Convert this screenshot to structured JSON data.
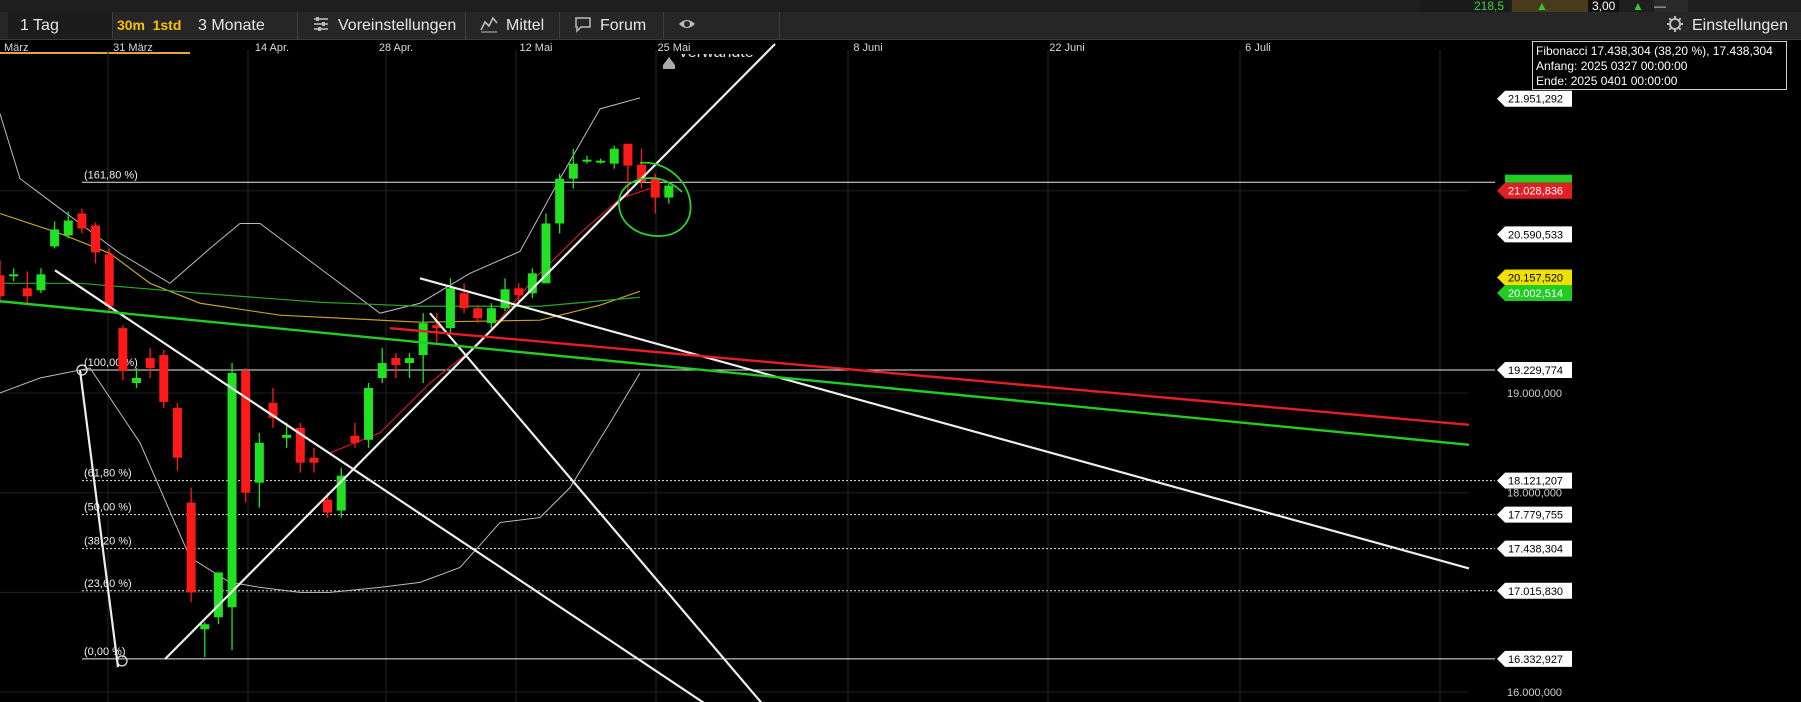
{
  "top_strip": {
    "value1": "218,5",
    "value2": "3,00",
    "tail": "—"
  },
  "toolbar": {
    "range_label": "1 Tag",
    "interval_a": "30m",
    "interval_b": "1std",
    "period_label": "3 Monate",
    "presets_label": "Voreinstellungen",
    "indicator_label": "Mittel",
    "forum_label": "Forum",
    "related_label": "Verwandte",
    "settings_label": "Einstellungen"
  },
  "tooltip": {
    "line1": "Fibonacci 17.438,304 (38,20 %), 17.438,304",
    "line2": "Anfang: 2025 0327 00:00:00",
    "line3": "Ende: 2025 0401 00:00:00"
  },
  "colors": {
    "up": "#22e022",
    "down": "#ff1a1a",
    "line": "#ffffff",
    "price_red": "#e31e24",
    "price_green": "#22cc22",
    "price_yellow": "#f0e000"
  },
  "chart_data": {
    "type": "candlestick",
    "ylim": [
      15900,
      22400
    ],
    "x_tick_labels": [
      "März",
      "31 März",
      "14 Apr.",
      "28 Apr.",
      "12 Mai",
      "25 Mai",
      "8 Juni",
      "22 Juni",
      "6 Juli"
    ],
    "y_tick_labels": [
      "19.000,000",
      "18.000,000",
      "16.000,000"
    ],
    "y_tick_values": [
      19000,
      18000,
      16000
    ],
    "price_labels": [
      {
        "text": "21.951,292",
        "value": 21951.292,
        "style": "white"
      },
      {
        "text": "21.028,836",
        "value": 21028.836,
        "style": "red"
      },
      {
        "text": "20.590,533",
        "value": 20590.533,
        "style": "white"
      },
      {
        "text": "20.157,520",
        "value": 20157.52,
        "style": "yellow"
      },
      {
        "text": "20.002,514",
        "value": 20002.514,
        "style": "green"
      },
      {
        "text": "19.229,774",
        "value": 19229.774,
        "style": "white"
      },
      {
        "text": "18.121,207",
        "value": 18121.207,
        "style": "white"
      },
      {
        "text": "17.779,755",
        "value": 17779.755,
        "style": "white"
      },
      {
        "text": "17.438,304",
        "value": 17438.304,
        "style": "white"
      },
      {
        "text": "17.015,830",
        "value": 17015.83,
        "style": "white"
      },
      {
        "text": "16.332,927",
        "value": 16332.927,
        "style": "white"
      }
    ],
    "fibonacci": [
      {
        "label": "(161,80 %)",
        "value": 21113.3
      },
      {
        "label": "(100,00 %)",
        "value": 19229.774
      },
      {
        "label": "(61,80 %)",
        "value": 18121.207
      },
      {
        "label": "(50,00 %)",
        "value": 17779.755
      },
      {
        "label": "(38,20 %)",
        "value": 17438.304
      },
      {
        "label": "(23,60 %)",
        "value": 17015.83
      },
      {
        "label": "(0,00 %)",
        "value": 16332.927
      }
    ],
    "candles": [
      {
        "o": 20180,
        "h": 20330,
        "l": 19900,
        "c": 19970
      },
      {
        "o": 20170,
        "h": 20250,
        "l": 20120,
        "c": 20190
      },
      {
        "o": 20050,
        "h": 20220,
        "l": 19880,
        "c": 19970
      },
      {
        "o": 20030,
        "h": 20250,
        "l": 20000,
        "c": 20190
      },
      {
        "o": 20470,
        "h": 20720,
        "l": 20450,
        "c": 20640
      },
      {
        "o": 20580,
        "h": 20820,
        "l": 20550,
        "c": 20730
      },
      {
        "o": 20800,
        "h": 20850,
        "l": 20600,
        "c": 20650
      },
      {
        "o": 20680,
        "h": 20710,
        "l": 20300,
        "c": 20410
      },
      {
        "o": 20390,
        "h": 20450,
        "l": 19800,
        "c": 19870
      },
      {
        "o": 19650,
        "h": 19680,
        "l": 19130,
        "c": 19220
      },
      {
        "o": 19100,
        "h": 19250,
        "l": 19050,
        "c": 19150
      },
      {
        "o": 19350,
        "h": 19450,
        "l": 19150,
        "c": 19250
      },
      {
        "o": 19380,
        "h": 19430,
        "l": 18850,
        "c": 18910
      },
      {
        "o": 18850,
        "h": 18900,
        "l": 18220,
        "c": 18350
      },
      {
        "o": 17900,
        "h": 18050,
        "l": 16900,
        "c": 17000
      },
      {
        "o": 16630,
        "h": 16700,
        "l": 16350,
        "c": 16680
      },
      {
        "o": 16750,
        "h": 17200,
        "l": 16680,
        "c": 17200
      },
      {
        "o": 16850,
        "h": 19300,
        "l": 16420,
        "c": 19200
      },
      {
        "o": 19220,
        "h": 19250,
        "l": 17900,
        "c": 18000
      },
      {
        "o": 18100,
        "h": 18600,
        "l": 17850,
        "c": 18500
      },
      {
        "o": 18900,
        "h": 19050,
        "l": 18650,
        "c": 18750
      },
      {
        "o": 18550,
        "h": 18700,
        "l": 18450,
        "c": 18580
      },
      {
        "o": 18650,
        "h": 18700,
        "l": 18200,
        "c": 18300
      },
      {
        "o": 18350,
        "h": 18450,
        "l": 18200,
        "c": 18300
      },
      {
        "o": 17930,
        "h": 18000,
        "l": 17750,
        "c": 17800
      },
      {
        "o": 17820,
        "h": 18250,
        "l": 17750,
        "c": 18170
      },
      {
        "o": 18570,
        "h": 18700,
        "l": 18450,
        "c": 18500
      },
      {
        "o": 18530,
        "h": 19100,
        "l": 18450,
        "c": 19050
      },
      {
        "o": 19150,
        "h": 19450,
        "l": 19100,
        "c": 19300
      },
      {
        "o": 19350,
        "h": 19400,
        "l": 19150,
        "c": 19280
      },
      {
        "o": 19300,
        "h": 19400,
        "l": 19150,
        "c": 19350
      },
      {
        "o": 19380,
        "h": 19800,
        "l": 19100,
        "c": 19700
      },
      {
        "o": 19680,
        "h": 19800,
        "l": 19500,
        "c": 19650
      },
      {
        "o": 19650,
        "h": 20150,
        "l": 19600,
        "c": 20050
      },
      {
        "o": 20000,
        "h": 20100,
        "l": 19800,
        "c": 19850
      },
      {
        "o": 19850,
        "h": 19880,
        "l": 19700,
        "c": 19750
      },
      {
        "o": 19700,
        "h": 19900,
        "l": 19650,
        "c": 19850
      },
      {
        "o": 19850,
        "h": 20150,
        "l": 19820,
        "c": 20040
      },
      {
        "o": 20050,
        "h": 20100,
        "l": 19900,
        "c": 19980
      },
      {
        "o": 20000,
        "h": 20250,
        "l": 19950,
        "c": 20200
      },
      {
        "o": 20100,
        "h": 20800,
        "l": 20100,
        "c": 20700
      },
      {
        "o": 20700,
        "h": 21200,
        "l": 20600,
        "c": 21150
      },
      {
        "o": 21150,
        "h": 21450,
        "l": 21050,
        "c": 21300
      },
      {
        "o": 21330,
        "h": 21380,
        "l": 21300,
        "c": 21340
      },
      {
        "o": 21330,
        "h": 21350,
        "l": 21300,
        "c": 21330
      },
      {
        "o": 21300,
        "h": 21480,
        "l": 21250,
        "c": 21450
      },
      {
        "o": 21500,
        "h": 21480,
        "l": 20970,
        "c": 21280
      },
      {
        "o": 21290,
        "h": 21450,
        "l": 21050,
        "c": 21120
      },
      {
        "o": 21150,
        "h": 21200,
        "l": 20800,
        "c": 20960
      },
      {
        "o": 20960,
        "h": 21100,
        "l": 20900,
        "c": 21080
      }
    ],
    "bollinger_upper": [
      [
        0,
        21800
      ],
      [
        20,
        21150
      ],
      [
        40,
        21000
      ],
      [
        120,
        20400
      ],
      [
        170,
        20100
      ],
      [
        210,
        20450
      ],
      [
        240,
        20700
      ],
      [
        260,
        20700
      ],
      [
        320,
        20250
      ],
      [
        380,
        19800
      ],
      [
        420,
        19900
      ],
      [
        470,
        20200
      ],
      [
        520,
        20420
      ],
      [
        560,
        21150
      ],
      [
        600,
        21850
      ],
      [
        640,
        21960
      ]
    ],
    "bollinger_lower": [
      [
        0,
        19000
      ],
      [
        40,
        19150
      ],
      [
        90,
        19250
      ],
      [
        140,
        18500
      ],
      [
        190,
        17350
      ],
      [
        230,
        17100
      ],
      [
        260,
        17050
      ],
      [
        300,
        17000
      ],
      [
        330,
        17000
      ],
      [
        380,
        17050
      ],
      [
        420,
        17100
      ],
      [
        460,
        17250
      ],
      [
        500,
        17700
      ],
      [
        540,
        17750
      ],
      [
        570,
        18050
      ],
      [
        610,
        18700
      ],
      [
        640,
        19200
      ]
    ],
    "sma_red": [
      [
        330,
        18400
      ],
      [
        380,
        18600
      ],
      [
        430,
        19100
      ],
      [
        480,
        19500
      ],
      [
        530,
        20100
      ],
      [
        580,
        20600
      ],
      [
        620,
        20950
      ],
      [
        650,
        21050
      ]
    ],
    "sma_orange": [
      [
        0,
        20800
      ],
      [
        60,
        20600
      ],
      [
        110,
        20400
      ],
      [
        150,
        20100
      ],
      [
        200,
        19900
      ],
      [
        280,
        19780
      ],
      [
        420,
        19710
      ],
      [
        540,
        19730
      ],
      [
        600,
        19880
      ],
      [
        640,
        20020
      ]
    ],
    "sma_green": [
      [
        0,
        20100
      ],
      [
        80,
        20100
      ],
      [
        200,
        20000
      ],
      [
        320,
        19910
      ],
      [
        420,
        19870
      ],
      [
        540,
        19870
      ],
      [
        640,
        19960
      ]
    ],
    "trendlines": [
      {
        "color": "white",
        "from": [
          55,
          20230
        ],
        "to": [
          710,
          15850
        ]
      },
      {
        "color": "white",
        "from": [
          165,
          16330
        ],
        "to": [
          775,
          22500
        ]
      },
      {
        "color": "white",
        "from": [
          420,
          20150
        ],
        "to": [
          1469,
          17240
        ]
      },
      {
        "color": "white",
        "from": [
          430,
          19800
        ],
        "to": [
          765,
          15850
        ]
      },
      {
        "color": "red",
        "from": [
          390,
          19650
        ],
        "to": [
          1469,
          18680
        ]
      },
      {
        "color": "green",
        "from": [
          0,
          19920
        ],
        "to": [
          1469,
          18480
        ]
      },
      {
        "color": "white",
        "from": [
          80,
          19230
        ],
        "to": [
          118,
          16250
        ]
      }
    ]
  }
}
